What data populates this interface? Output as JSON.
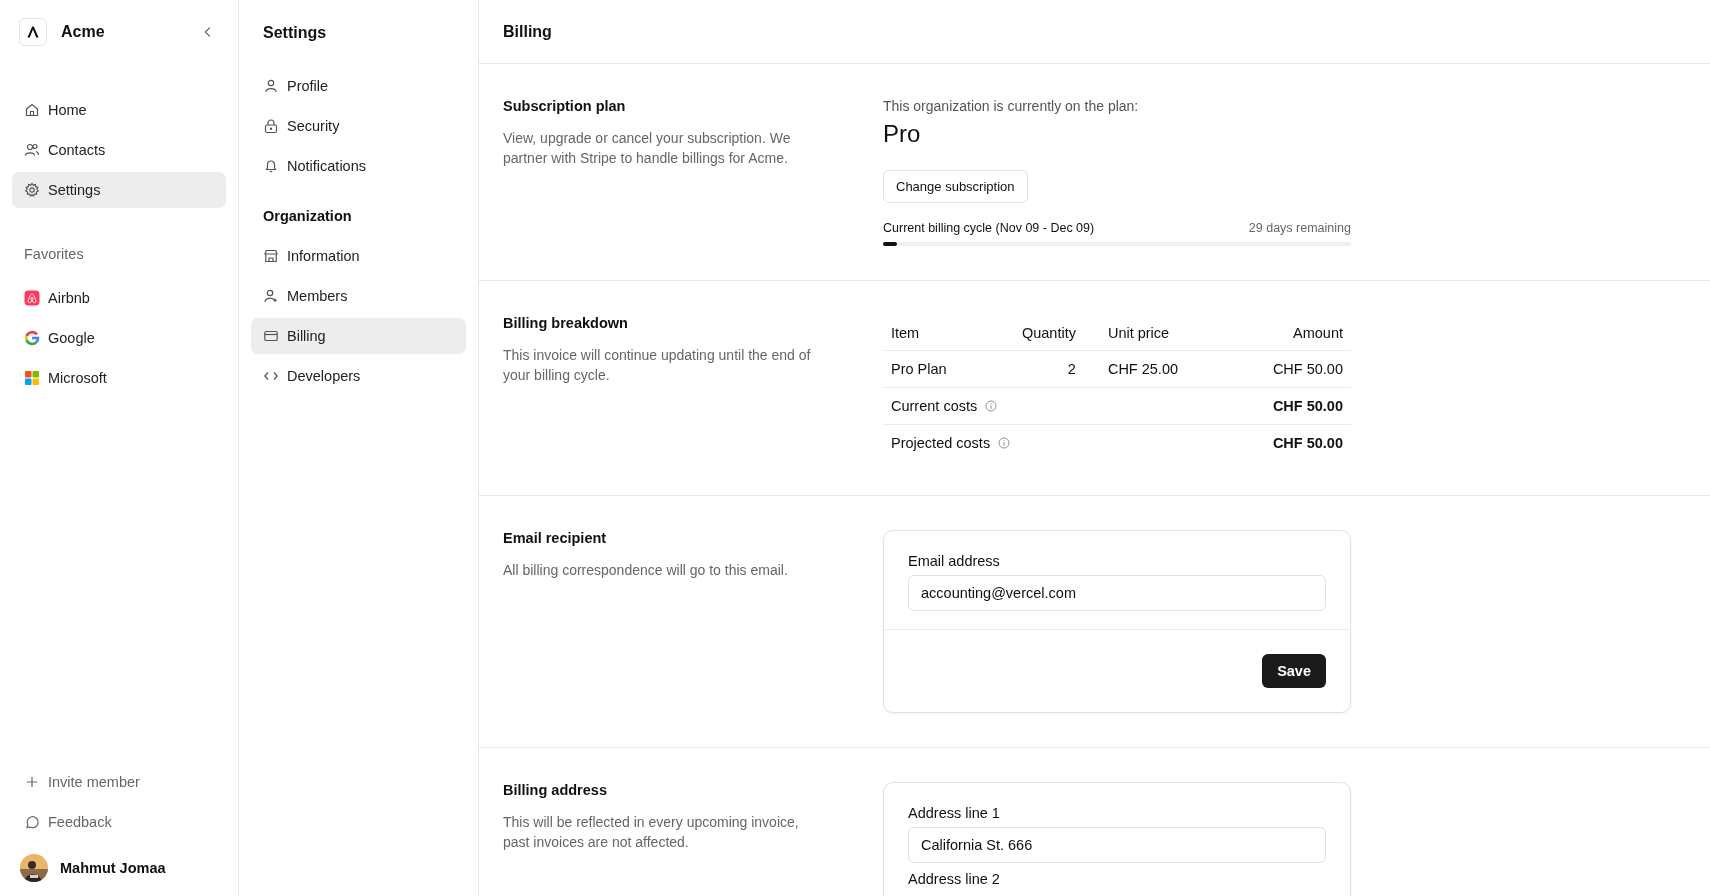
{
  "workspace": {
    "name": "Acme"
  },
  "sidebar": {
    "nav": [
      {
        "label": "Home",
        "selected": false
      },
      {
        "label": "Contacts",
        "selected": false
      },
      {
        "label": "Settings",
        "selected": true
      }
    ],
    "favorites_title": "Favorites",
    "favorites": [
      {
        "label": "Airbnb"
      },
      {
        "label": "Google"
      },
      {
        "label": "Microsoft"
      }
    ],
    "footer": [
      {
        "label": "Invite member"
      },
      {
        "label": "Feedback"
      }
    ],
    "user": {
      "name": "Mahmut Jomaa"
    }
  },
  "settings_nav": {
    "title": "Settings",
    "groups": [
      {
        "items": [
          {
            "label": "Profile",
            "selected": false
          },
          {
            "label": "Security",
            "selected": false
          },
          {
            "label": "Notifications",
            "selected": false
          }
        ]
      },
      {
        "title": "Organization",
        "items": [
          {
            "label": "Information",
            "selected": false
          },
          {
            "label": "Members",
            "selected": false
          },
          {
            "label": "Billing",
            "selected": true
          },
          {
            "label": "Developers",
            "selected": false
          }
        ]
      }
    ]
  },
  "page": {
    "title": "Billing",
    "sections": [
      {
        "kind": "plan",
        "title": "Subscription plan",
        "description": "View, upgrade or cancel your subscription. We partner with Stripe to handle billings for Acme.",
        "plan_caption": "This organization is currently on the plan:",
        "plan": "Pro",
        "button": "Change subscription",
        "cycle_label": "Current billing cycle (Nov 09 - Dec 09)",
        "cycle_remaining": "29 days remaining",
        "level": 0.03
      },
      {
        "kind": "table",
        "title": "Billing breakdown",
        "description": "This invoice will continue updating until the end of your billing cycle.",
        "columns": [
          "Item",
          "Quantity",
          "Unit price",
          "Amount"
        ],
        "rows": [
          [
            "Pro Plan",
            "2",
            "CHF 25.00",
            "CHF 50.00"
          ]
        ],
        "totals": [
          {
            "label": "Current costs",
            "amount": "CHF 50.00"
          },
          {
            "label": "Projected costs",
            "amount": "CHF 50.00"
          }
        ]
      },
      {
        "kind": "form",
        "title": "Email recipient",
        "description": "All billing correspondence will go to this email.",
        "fields": [
          {
            "label": "Email address",
            "value": "accounting@vercel.com"
          }
        ],
        "button": "Save"
      },
      {
        "kind": "form",
        "title": "Billing address",
        "description": "This will be reflected in every upcoming invoice, past invoices are not affected.",
        "fields": [
          {
            "label": "Address line 1",
            "value": "California St. 666"
          }
        ],
        "cut_label": "Address line 2"
      }
    ]
  }
}
